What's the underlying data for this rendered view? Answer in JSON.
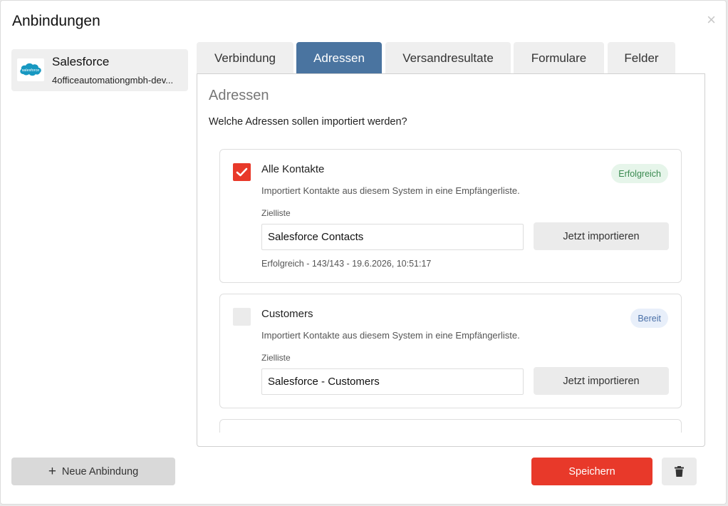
{
  "dialog": {
    "title": "Anbindungen",
    "close_label": "×"
  },
  "sidebar": {
    "items": [
      {
        "name": "Salesforce",
        "account": "4officeautomationgmbh-dev...",
        "logo_text": "salesforce",
        "logo_color": "#1798c1"
      }
    ]
  },
  "tabs": [
    {
      "label": "Verbindung",
      "active": false
    },
    {
      "label": "Adressen",
      "active": true
    },
    {
      "label": "Versandresultate",
      "active": false
    },
    {
      "label": "Formulare",
      "active": false
    },
    {
      "label": "Felder",
      "active": false
    }
  ],
  "panel": {
    "title": "Adressen",
    "question": "Welche Adressen sollen importiert werden?",
    "cards": [
      {
        "checked": true,
        "title": "Alle Kontakte",
        "badge": "Erfolgreich",
        "description": "Importiert Kontakte aus diesem System in eine Empfängerliste.",
        "target_label": "Zielliste",
        "target_value": "Salesforce Contacts",
        "button_label": "Jetzt importieren",
        "status": "Erfolgreich - 143/143 - 19.6.2026, 10:51:17"
      },
      {
        "checked": false,
        "title": "Customers",
        "badge": "Bereit",
        "description": "Importiert Kontakte aus diesem System in eine Empfängerliste.",
        "target_label": "Zielliste",
        "target_value": "Salesforce - Customers",
        "button_label": "Jetzt importieren"
      }
    ]
  },
  "footer": {
    "new_button_label": "Neue Anbindung",
    "save_label": "Speichern"
  },
  "colors": {
    "accent": "#e8392a",
    "active_tab": "#4a74a0",
    "success_badge_bg": "#e6f5ea",
    "ready_badge_bg": "#e8effa"
  }
}
